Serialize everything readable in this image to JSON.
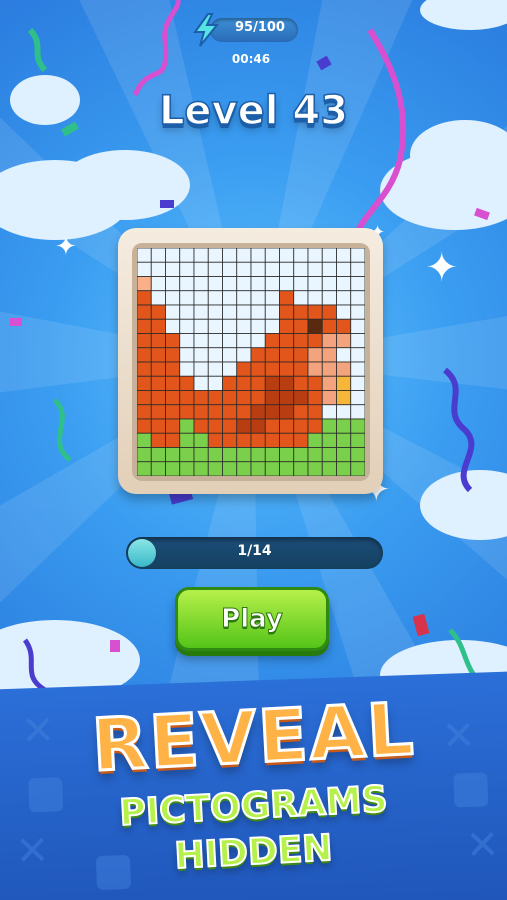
{
  "energy": {
    "text": "95/100",
    "value": 95,
    "max": 100
  },
  "timer": {
    "text": "00:46"
  },
  "level": {
    "title": "Level 43"
  },
  "puzzle": {
    "grid_size": 16,
    "palette": {
      "W": "#e9f6ff",
      "O": "#e2561c",
      "D": "#b83d10",
      "P": "#f3a37d",
      "Y": "#f5b63a",
      "K": "#5a2a10",
      "G": "#7ad04a",
      "L": "#f9b089"
    },
    "rows": [
      "WWWWWWWWWWWWWWWW",
      "WWWWWWWWWWWWWWWW",
      "LWWWWWWWWWWWWWWW",
      "OWWWWWWWWWOWWWWW",
      "OOWWWWWWWWOOOOWW",
      "OOWWWWWWWWOOKOOW",
      "OOOWWWWWWOOOOPPW",
      "OOOWWWWWOOOOPPWW",
      "OOOWWWWOOOOOPPPW",
      "OOOOWWOOODDOOPYW",
      "OOOOOOOOODDDOPYW",
      "OOOOOOOODDDOOWWW",
      "OOOGOOODDOOOOGGG",
      "GOOGGOOOOOOOGGGG",
      "GGGGGGGGGGGGGGGG",
      "GGGGGGGGGGGGGGGG"
    ]
  },
  "progress": {
    "text": "1/14",
    "current": 1,
    "total": 14
  },
  "play_button": {
    "label": "Play"
  },
  "promo": {
    "headline": "REVEAL",
    "line1": "PICTOGRAMS",
    "line2": "HIDDEN"
  },
  "colors": {
    "accent_green": "#54c418",
    "headline_orange": "#ffb347",
    "background_blue": "#3a9cf0"
  }
}
